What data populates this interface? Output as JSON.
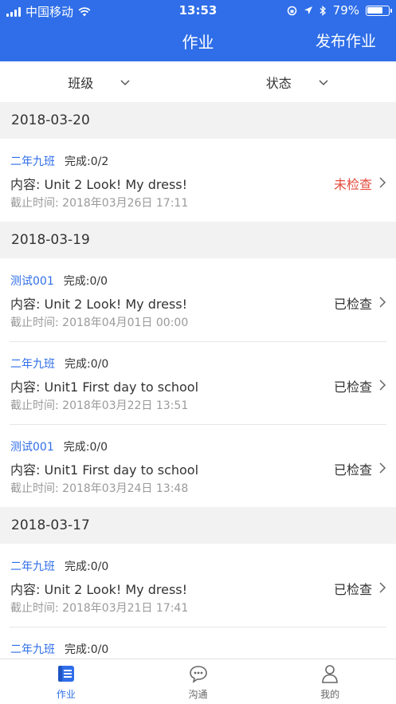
{
  "status_bar": {
    "carrier": "中国移动",
    "time": "13:53",
    "battery": "79%",
    "battery_level": 0.79
  },
  "nav": {
    "title": "作业",
    "action": "发布作业"
  },
  "filters": {
    "class_label": "班级",
    "status_label": "状态"
  },
  "groups": [
    {
      "date": "2018-03-20",
      "items": [
        {
          "class": "二年九班",
          "completion": "完成:0/2",
          "content": "内容: Unit 2 Look! My dress!",
          "deadline": "截止时间: 2018年03月26日 17:11",
          "status": "未检查"
        }
      ]
    },
    {
      "date": "2018-03-19",
      "items": [
        {
          "class": "测试001",
          "completion": "完成:0/0",
          "content": "内容: Unit 2 Look! My dress!",
          "deadline": "截止时间: 2018年04月01日 00:00",
          "status": "已检查"
        },
        {
          "class": "二年九班",
          "completion": "完成:0/0",
          "content": "内容: Unit1 First day to school",
          "deadline": "截止时间: 2018年03月22日 13:51",
          "status": "已检查"
        },
        {
          "class": "测试001",
          "completion": "完成:0/0",
          "content": "内容: Unit1 First day to school",
          "deadline": "截止时间: 2018年03月24日 13:48",
          "status": "已检查"
        }
      ]
    },
    {
      "date": "2018-03-17",
      "items": [
        {
          "class": "二年九班",
          "completion": "完成:0/0",
          "content": "内容: Unit 2 Look! My dress!",
          "deadline": "截止时间: 2018年03月21日 17:41",
          "status": "已检查"
        },
        {
          "class": "二年九班",
          "completion": "完成:0/0"
        }
      ]
    }
  ],
  "tabs": [
    {
      "label": "作业",
      "icon": "homework-icon",
      "active": true
    },
    {
      "label": "沟通",
      "icon": "chat-icon",
      "active": false
    },
    {
      "label": "我的",
      "icon": "user-icon",
      "active": false
    }
  ],
  "colors": {
    "primary": "#2f6ee8",
    "unchecked": "#e54d3e"
  }
}
